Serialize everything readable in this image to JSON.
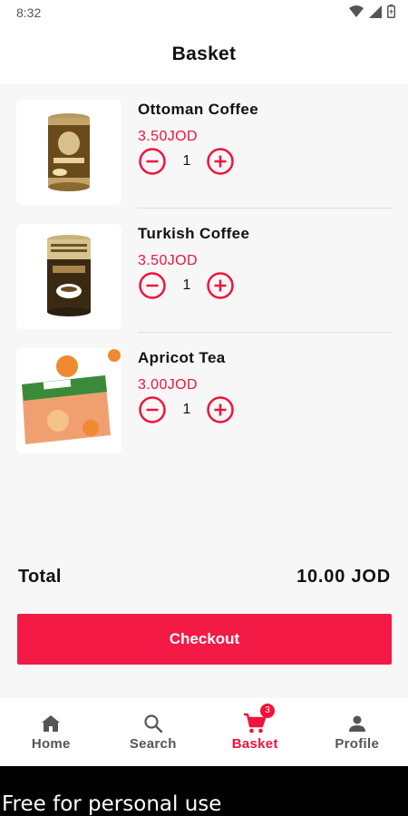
{
  "status_bar": {
    "time": "8:32"
  },
  "header": {
    "title": "Basket"
  },
  "items": [
    {
      "name": "Ottoman Coffee",
      "price": "3.50JOD",
      "quantity": "1",
      "image": "ottoman-coffee-can"
    },
    {
      "name": "Turkish Coffee",
      "price": "3.50JOD",
      "quantity": "1",
      "image": "turkish-coffee-can"
    },
    {
      "name": "Apricot Tea",
      "price": "3.00JOD",
      "quantity": "1",
      "image": "apricot-tea-box"
    }
  ],
  "summary": {
    "total_label": "Total",
    "total_value": "10.00 JOD"
  },
  "checkout": {
    "label": "Checkout"
  },
  "nav": {
    "items": [
      {
        "label": "Home",
        "icon": "home-icon"
      },
      {
        "label": "Search",
        "icon": "search-icon"
      },
      {
        "label": "Basket",
        "icon": "cart-icon",
        "badge": "3",
        "active": true
      },
      {
        "label": "Profile",
        "icon": "person-icon"
      }
    ]
  },
  "watermark": {
    "text": "Free for personal use"
  },
  "colors": {
    "accent": "#f0133c",
    "button": "#f31a45",
    "background": "#f7f7f7"
  }
}
